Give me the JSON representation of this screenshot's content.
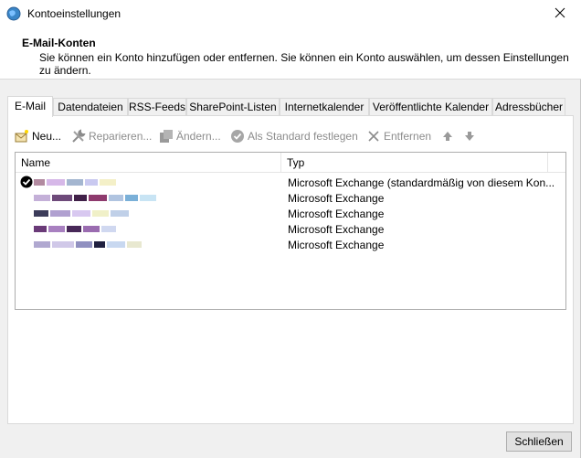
{
  "window": {
    "title": "Kontoeinstellungen"
  },
  "header": {
    "title": "E-Mail-Konten",
    "description": "Sie können ein Konto hinzufügen oder entfernen. Sie können ein Konto auswählen, um dessen Einstellungen zu ändern."
  },
  "tabs": [
    {
      "label": "E-Mail"
    },
    {
      "label": "Datendateien"
    },
    {
      "label": "RSS-Feeds"
    },
    {
      "label": "SharePoint-Listen"
    },
    {
      "label": "Internetkalender"
    },
    {
      "label": "Veröffentlichte Kalender"
    },
    {
      "label": "Adressbücher"
    }
  ],
  "toolbar": {
    "new_label": "Neu...",
    "repair_label": "Reparieren...",
    "change_label": "Ändern...",
    "default_label": "Als Standard festlegen",
    "remove_label": "Entfernen"
  },
  "list": {
    "col_name": "Name",
    "col_type": "Typ",
    "rows": [
      {
        "type": "Microsoft Exchange (standardmäßig von diesem Kon..."
      },
      {
        "type": "Microsoft Exchange"
      },
      {
        "type": "Microsoft Exchange"
      },
      {
        "type": "Microsoft Exchange"
      },
      {
        "type": "Microsoft Exchange"
      }
    ]
  },
  "footer": {
    "close_label": "Schließen"
  },
  "icons": {
    "title": "globe-icon",
    "close": "close-icon",
    "new": "new-mail-icon",
    "repair": "wrench-icon",
    "change": "edit-icon",
    "default": "check-circle-icon",
    "remove": "x-icon",
    "up": "arrow-up-icon",
    "down": "arrow-down-icon",
    "default_account": "checkmark-icon"
  },
  "colors": {
    "accent": "#0078d7",
    "disabled_text": "#8c8c8c"
  }
}
